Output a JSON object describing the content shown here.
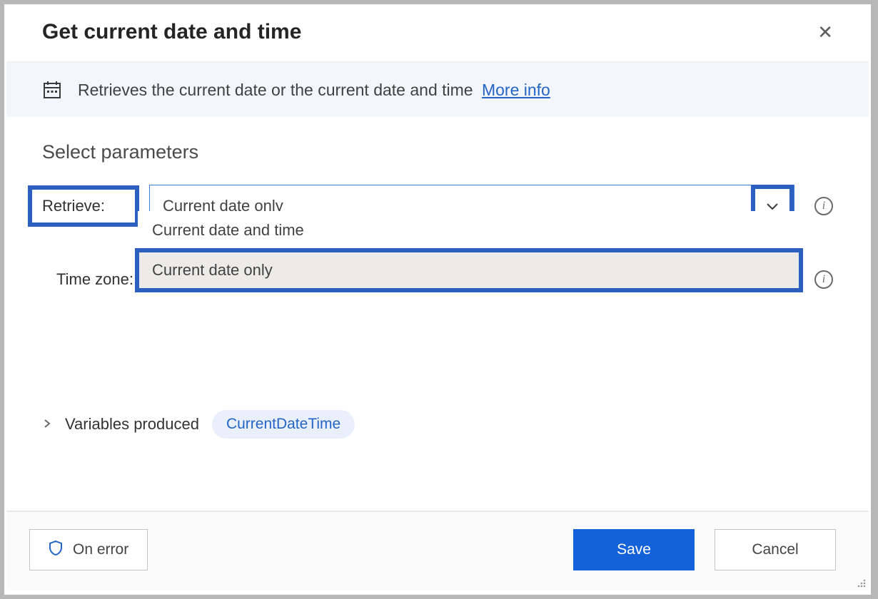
{
  "dialog": {
    "title": "Get current date and time",
    "close_label": "✕"
  },
  "info": {
    "description": "Retrieves the current date or the current date and time",
    "more_info": "More info"
  },
  "section": {
    "title": "Select parameters"
  },
  "retrieve": {
    "label": "Retrieve:",
    "value": "Current date only",
    "options": [
      "Current date and time",
      "Current date only"
    ],
    "selected_index": 1
  },
  "timezone": {
    "label": "Time zone:"
  },
  "variables": {
    "label": "Variables produced",
    "output": "CurrentDateTime"
  },
  "footer": {
    "on_error": "On error",
    "save": "Save",
    "cancel": "Cancel"
  },
  "highlight_color": "#2c5fc0"
}
